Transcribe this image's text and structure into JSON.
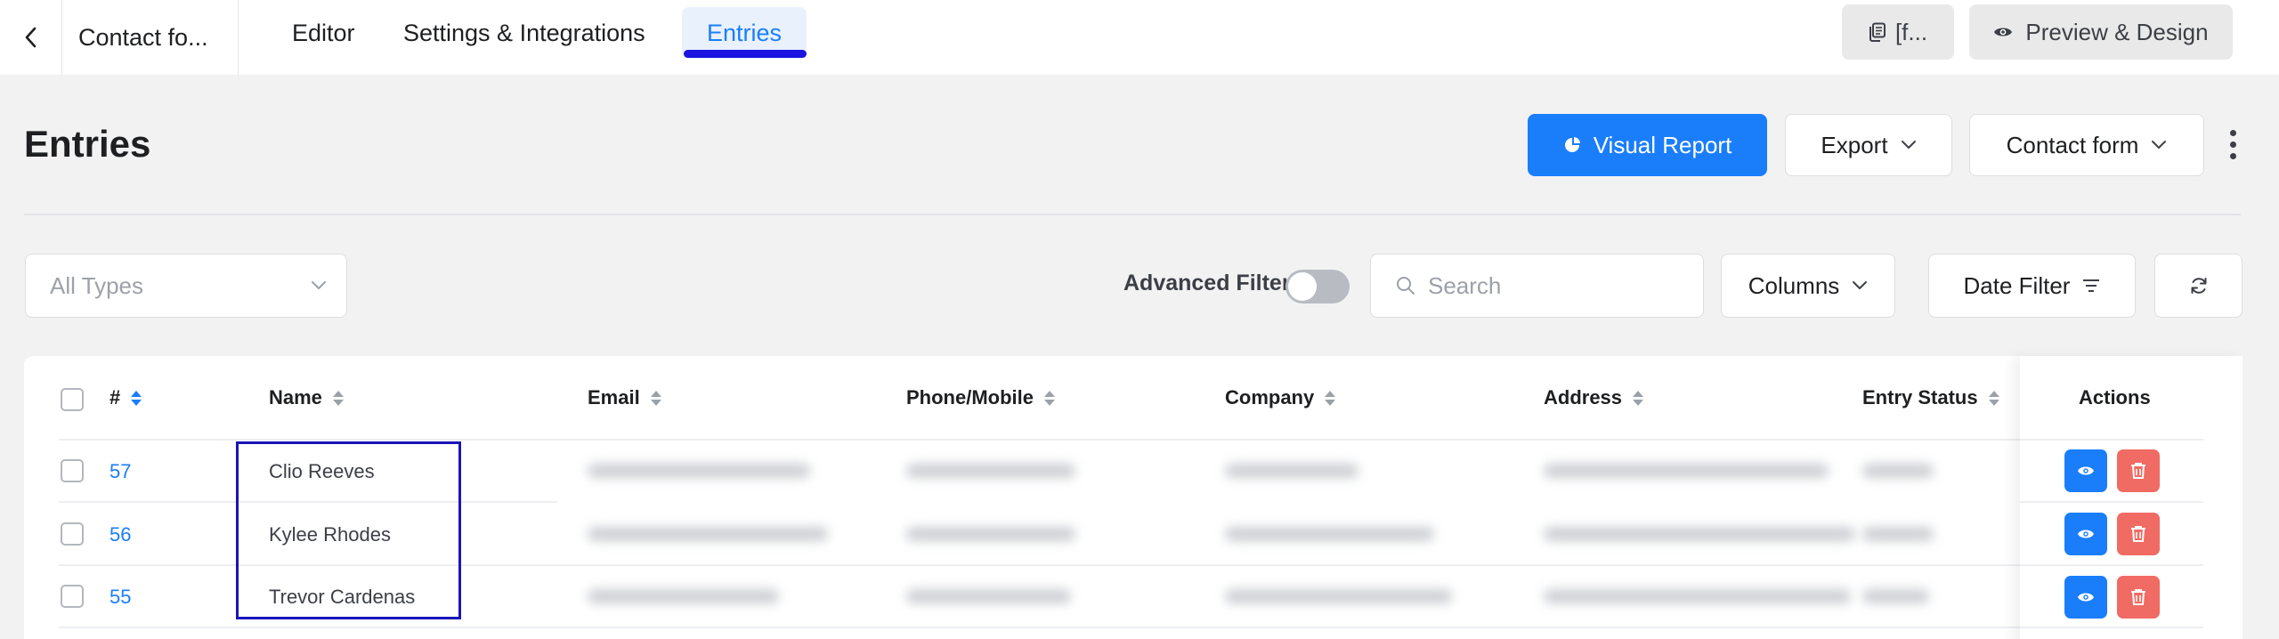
{
  "topbar": {
    "form_title": "Contact fo...",
    "tabs": [
      {
        "label": "Editor"
      },
      {
        "label": "Settings & Integrations"
      },
      {
        "label": "Entries",
        "active": true
      }
    ],
    "shortcode_label": "[f...",
    "preview_label": "Preview & Design"
  },
  "header": {
    "title": "Entries",
    "visual_report_label": "Visual Report",
    "export_label": "Export",
    "form_select_label": "Contact form"
  },
  "filters": {
    "types_placeholder": "All Types",
    "advanced_filter_label": "Advanced Filter",
    "advanced_filter_enabled": false,
    "search_placeholder": "Search",
    "columns_label": "Columns",
    "date_filter_label": "Date Filter"
  },
  "table": {
    "columns": [
      "#",
      "Name",
      "Email",
      "Phone/Mobile",
      "Company",
      "Address",
      "Entry Status",
      "Actions"
    ],
    "rows": [
      {
        "id": "57",
        "name": "Clio Reeves"
      },
      {
        "id": "56",
        "name": "Kylee Rhodes"
      },
      {
        "id": "55",
        "name": "Trevor Cardenas"
      }
    ]
  },
  "colors": {
    "accent": "#1a7efb",
    "danger": "#f06b63",
    "highlight_border": "#1b14b8"
  },
  "icons": [
    "chevron-left-icon",
    "copy-icon",
    "eye-icon",
    "pie-chart-icon",
    "chevron-down-icon",
    "kebab-menu-icon",
    "search-icon",
    "filter-lines-icon",
    "refresh-icon",
    "sort-icon",
    "trash-icon"
  ]
}
